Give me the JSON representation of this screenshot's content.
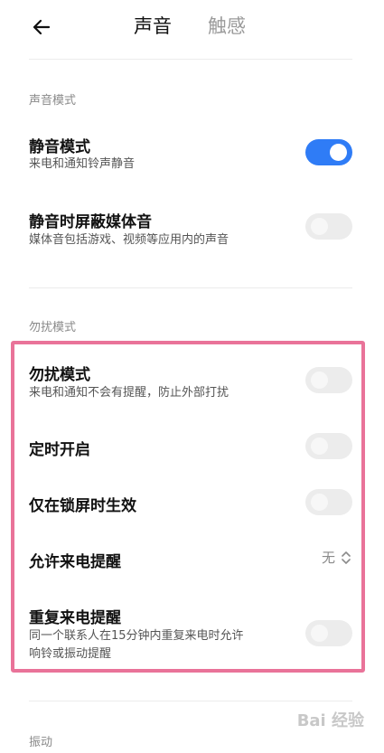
{
  "header": {
    "back_icon": "arrow-left-icon",
    "tabs": [
      {
        "label": "声音",
        "active": true
      },
      {
        "label": "触感",
        "active": false
      }
    ]
  },
  "sections": {
    "sound_mode": {
      "title": "声音模式",
      "items": [
        {
          "title": "静音模式",
          "subtitle": "来电和通知铃声静音",
          "toggle": "on"
        },
        {
          "title": "静音时屏蔽媒体音",
          "subtitle": "媒体音包括游戏、视频等应用内的声音",
          "toggle": "off"
        }
      ]
    },
    "dnd": {
      "title": "勿扰模式",
      "items": [
        {
          "title": "勿扰模式",
          "subtitle": "来电和通知不会有提醒，防止外部打扰",
          "toggle": "off"
        },
        {
          "title": "定时开启",
          "toggle": "off"
        },
        {
          "title": "仅在锁屏时生效",
          "toggle": "off"
        },
        {
          "title": "允许来电提醒",
          "value": "无"
        },
        {
          "title": "重复来电提醒",
          "subtitle_lines": [
            "同一个联系人在15分钟内重复来电时允许",
            "响铃或振动提醒"
          ],
          "toggle": "off"
        }
      ]
    },
    "vibration": {
      "title": "振动"
    }
  },
  "watermark": "Bai 经验",
  "colors": {
    "toggle_on": "#2f7cf6",
    "toggle_off": "#ececec",
    "highlight": "#e97399"
  }
}
